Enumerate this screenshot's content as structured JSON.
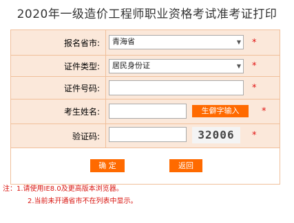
{
  "page": {
    "title": "2020年一级造价工程师职业资格考试准考证打印"
  },
  "form": {
    "province": {
      "label": "报名省市:",
      "value": "青海省"
    },
    "id_type": {
      "label": "证件类型:",
      "value": "居民身份证"
    },
    "id_number": {
      "label": "证件号码:",
      "value": ""
    },
    "name": {
      "label": "考生姓名:",
      "value": "",
      "rare_char_button": "生僻字输入"
    },
    "captcha": {
      "label": "验证码:",
      "value": "",
      "image_text": "32006"
    },
    "required_mark": "*"
  },
  "buttons": {
    "confirm": "确 定",
    "back": "返回"
  },
  "notes": {
    "line1": "注：1.请使用IE8.0及更高版本浏览器。",
    "line2": "2.当前未开通省市不在列表中显示。"
  },
  "colors": {
    "accent": "#ff6a00",
    "label_bg": "#fbe8da",
    "border": "#f0bf9a",
    "note": "#d9140f"
  }
}
